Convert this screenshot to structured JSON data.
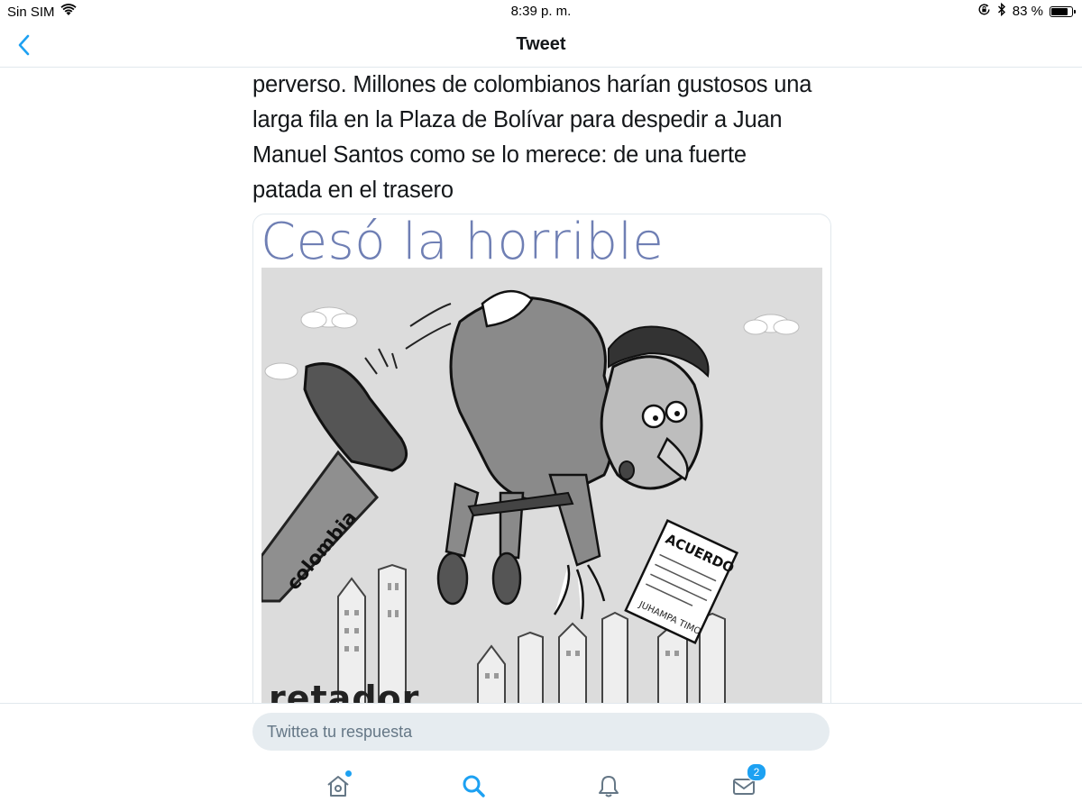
{
  "status_bar": {
    "carrier": "Sin SIM",
    "time": "8:39 p. m.",
    "battery_percent": "83 %",
    "battery_level": 0.83,
    "icons": [
      "wifi-icon",
      "orientation-lock-icon",
      "bluetooth-icon",
      "battery-icon"
    ]
  },
  "nav": {
    "title": "Tweet",
    "back_icon": "chevron-left-icon"
  },
  "tweet": {
    "text_lines": [
      "perverso. Millones de colombianos harían gustosos una",
      "larga fila en la Plaza de Bolívar para despedir a Juan",
      "Manuel Santos como se lo merece: de una fuerte",
      "patada en el trasero"
    ],
    "media": {
      "headline": "Cesó la horrible noche",
      "leg_label": "colombia",
      "paper_label": "ACUERDO",
      "paper_names": "JUHAMPA TIMO",
      "signature": "retador"
    }
  },
  "reply": {
    "placeholder": "Twittea tu respuesta"
  },
  "tabbar": {
    "home_icon": "home-icon",
    "search_icon": "search-icon",
    "notifications_icon": "bell-icon",
    "messages_icon": "envelope-icon",
    "messages_badge": "2"
  },
  "colors": {
    "accent": "#1da1f2",
    "headline": "#6f7fb4",
    "input_bg": "#e6ecf0",
    "placeholder": "#657786"
  }
}
